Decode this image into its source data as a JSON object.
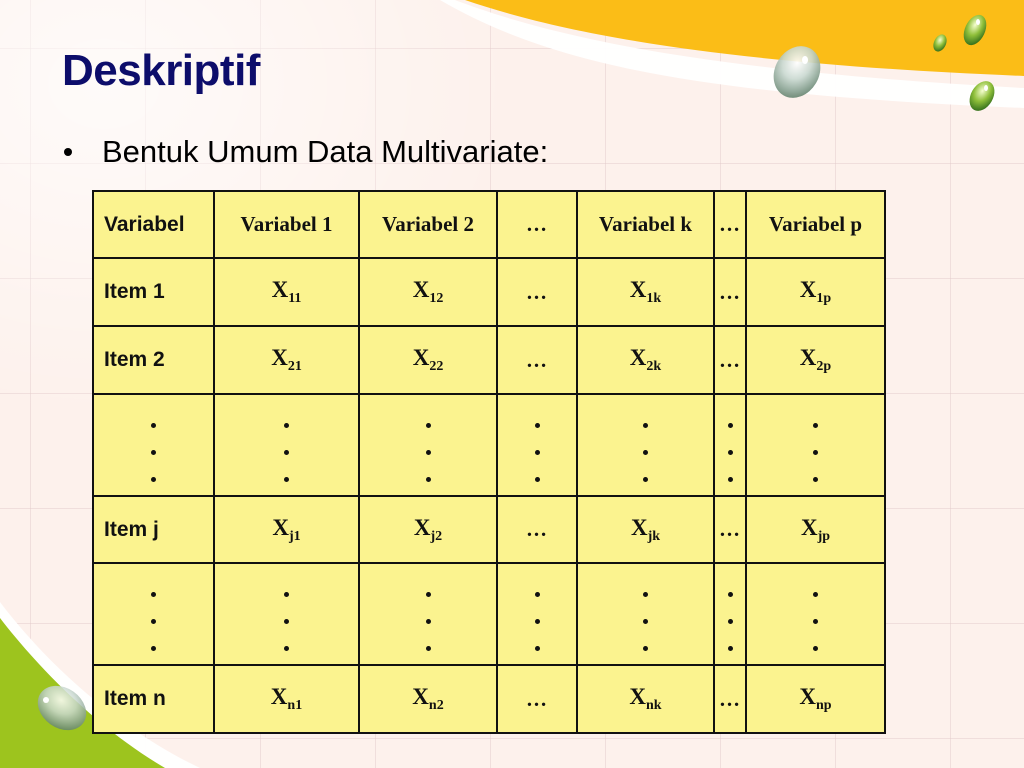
{
  "slide": {
    "title": "Deskriptif",
    "bullet": "Bentuk Umum Data Multivariate:"
  },
  "colors": {
    "title": "#0d0d6b",
    "table_fill": "#fbf38f",
    "accent_orange": "#fbbd17",
    "accent_green": "#9dc41e",
    "background": "#fdf1ec"
  },
  "table": {
    "header": [
      "Variabel",
      "Variabel 1",
      "Variabel 2",
      "…",
      "Variabel k",
      "…",
      "Variabel p"
    ],
    "rows": [
      {
        "label": "Item 1",
        "cells": [
          {
            "base": "X",
            "sub": "11"
          },
          {
            "base": "X",
            "sub": "12"
          },
          {
            "text": "…"
          },
          {
            "base": "X",
            "sub": "1k"
          },
          {
            "text": "…"
          },
          {
            "base": "X",
            "sub": "1p"
          }
        ]
      },
      {
        "label": "Item 2",
        "cells": [
          {
            "base": "X",
            "sub": "21"
          },
          {
            "base": "X",
            "sub": "22"
          },
          {
            "text": "…"
          },
          {
            "base": "X",
            "sub": "2k"
          },
          {
            "text": "…"
          },
          {
            "base": "X",
            "sub": "2p"
          }
        ]
      },
      {
        "label": "vertical-ellipsis"
      },
      {
        "label": "Item j",
        "cells": [
          {
            "base": "X",
            "sub": "j1"
          },
          {
            "base": "X",
            "sub": "j2"
          },
          {
            "text": "…"
          },
          {
            "base": "X",
            "sub": "jk"
          },
          {
            "text": "…"
          },
          {
            "base": "X",
            "sub": "jp"
          }
        ]
      },
      {
        "label": "vertical-ellipsis"
      },
      {
        "label": "Item n",
        "cells": [
          {
            "base": "X",
            "sub": "n1"
          },
          {
            "base": "X",
            "sub": "n2"
          },
          {
            "text": "…"
          },
          {
            "base": "X",
            "sub": "nk"
          },
          {
            "text": "…"
          },
          {
            "base": "X",
            "sub": "np"
          }
        ]
      }
    ]
  },
  "decorations": [
    "orange-swoosh",
    "green-swoosh",
    "water-droplet-icon"
  ]
}
